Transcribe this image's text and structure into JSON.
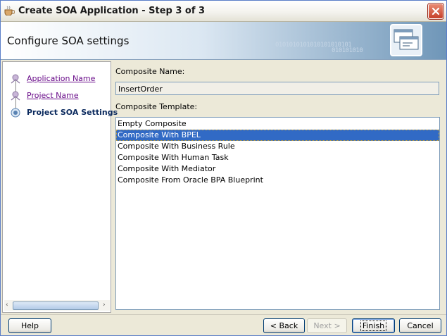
{
  "window": {
    "title": "Create SOA Application - Step 3 of 3"
  },
  "header": {
    "title": "Configure SOA settings",
    "binary_a": "0101010101010101010101",
    "binary_b": "010101010"
  },
  "nav": {
    "items": [
      {
        "label": "Application Name",
        "state": "done"
      },
      {
        "label": "Project Name",
        "state": "done"
      },
      {
        "label": "Project SOA Settings",
        "state": "current"
      }
    ]
  },
  "form": {
    "composite_name_label": "Composite Name:",
    "composite_name_value": "InsertOrder",
    "composite_template_label": "Composite Template:",
    "templates": [
      "Empty Composite",
      "Composite With BPEL",
      "Composite With Business Rule",
      "Composite With Human Task",
      "Composite With Mediator",
      "Composite From Oracle BPA Blueprint"
    ],
    "selected_template": "Composite With BPEL"
  },
  "buttons": {
    "help": "Help",
    "back": "< Back",
    "next": "Next >",
    "finish": "Finish",
    "cancel": "Cancel"
  },
  "colors": {
    "selection": "#316ac5",
    "link": "#6a0d8a",
    "current_step": "#0b2a5e"
  }
}
